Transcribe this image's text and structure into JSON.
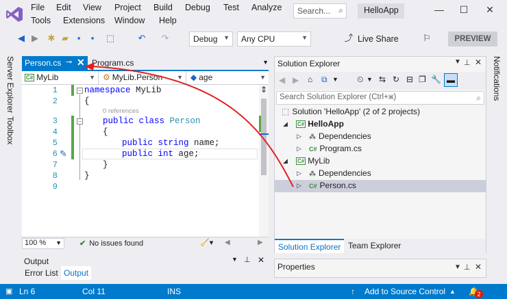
{
  "menu": {
    "items": [
      "File",
      "Edit",
      "View",
      "Project",
      "Build",
      "Debug",
      "Test",
      "Analyze",
      "Tools",
      "Extensions",
      "Window",
      "Help"
    ],
    "search_placeholder": "Search...",
    "app_name": "HelloApp"
  },
  "toolbar": {
    "config": "Debug",
    "platform": "Any CPU",
    "live_share": "Live Share",
    "preview": "PREVIEW"
  },
  "side_tabs": {
    "server_explorer": "Server Explorer",
    "toolbox": "Toolbox",
    "notifications": "Notifications"
  },
  "editor": {
    "tabs": [
      {
        "label": "Person.cs",
        "active": true
      },
      {
        "label": "Program.cs",
        "active": false
      }
    ],
    "nav": {
      "project": "MyLib",
      "type": "MyLib.Person",
      "member": "age"
    },
    "line_numbers": [
      "1",
      "2",
      "3",
      "4",
      "5",
      "6",
      "7",
      "8",
      "9"
    ],
    "code": {
      "l1_kw": "namespace",
      "l1_name": " MyLib",
      "l2": "{",
      "refs": "0 references",
      "l3_kw": "public class",
      "l3_type": "Person",
      "l4": "{",
      "l5_kw": "public string",
      "l5_name": " name;",
      "l6_kw": "public int",
      "l6_name": " age;",
      "l7": "}",
      "l8": "}"
    },
    "zoom": "100 %",
    "issues": "No issues found"
  },
  "output": {
    "title": "Output",
    "tabs": [
      "Error List",
      "Output"
    ]
  },
  "solution_explorer": {
    "title": "Solution Explorer",
    "search_placeholder": "Search Solution Explorer (Ctrl+ж)",
    "tree": {
      "solution": "Solution 'HelloApp' (2 of 2 projects)",
      "project1": "HelloApp",
      "p1_deps": "Dependencies",
      "p1_file": "Program.cs",
      "project2": "MyLib",
      "p2_deps": "Dependencies",
      "p2_file": "Person.cs"
    },
    "tabs": [
      "Solution Explorer",
      "Team Explorer"
    ]
  },
  "properties": {
    "title": "Properties"
  },
  "statusbar": {
    "ln": "Ln 6",
    "col": "Col 11",
    "mode": "INS",
    "source_control": "Add to Source Control",
    "notif_count": "2"
  },
  "colors": {
    "accent": "#007acc",
    "annotation": "#e02020",
    "keyword": "#0000ff",
    "type": "#2b91af"
  }
}
